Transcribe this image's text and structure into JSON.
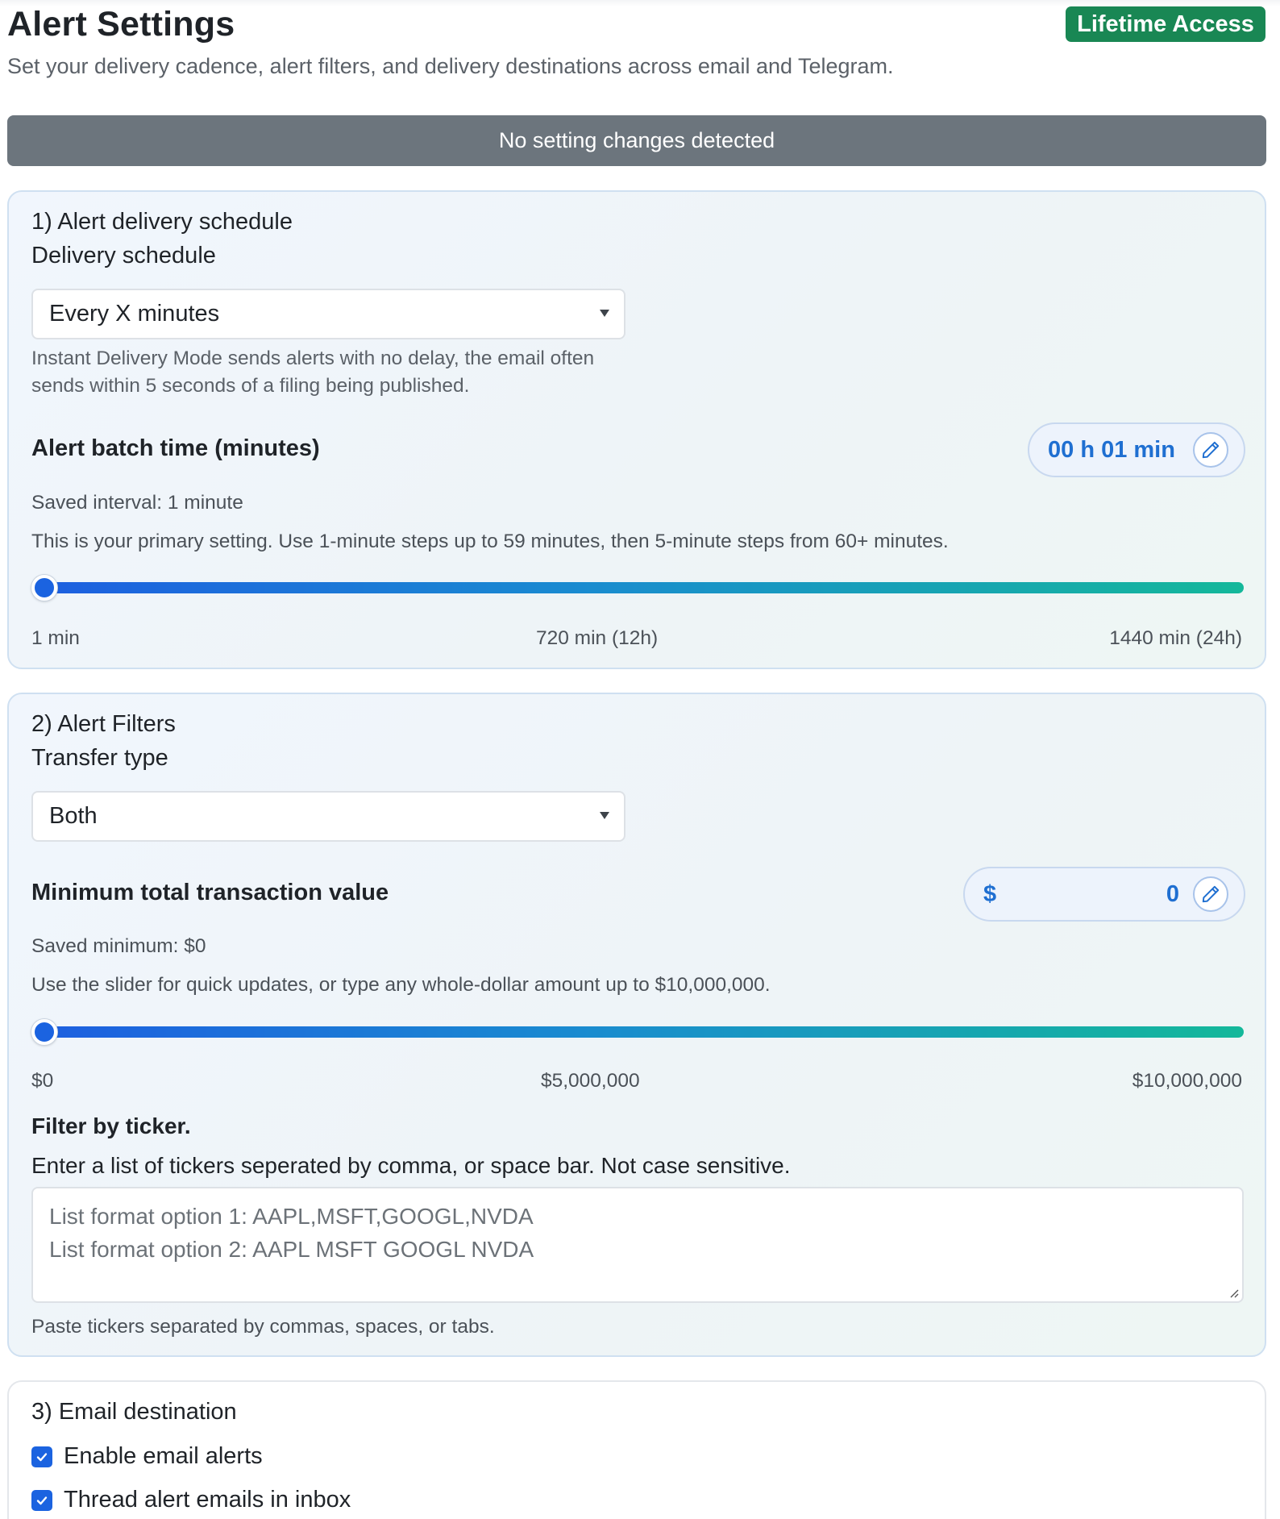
{
  "header": {
    "title": "Alert Settings",
    "badge": "Lifetime Access",
    "subtitle": "Set your delivery cadence, alert filters, and delivery destinations across email and Telegram."
  },
  "status": {
    "text": "No setting changes detected"
  },
  "schedule_section": {
    "title": "1) Alert delivery schedule",
    "schedule_label": "Delivery schedule",
    "schedule_value": "Every X minutes",
    "schedule_help_line1": "Instant Delivery Mode sends alerts with no delay, the email often",
    "schedule_help_line2": "sends within 5 seconds of a filing being published.",
    "batch_label": "Alert batch time (minutes)",
    "batch_display": "00 h 01 min",
    "saved_interval": "Saved interval: 1 minute",
    "batch_help": "This is your primary setting. Use 1-minute steps up to 59 minutes, then 5-minute steps from 60+ minutes.",
    "slider": {
      "value": 1,
      "min": 1,
      "max": 1440
    },
    "ticks": [
      "1 min",
      "720 min (12h)",
      "1440 min (24h)"
    ]
  },
  "filters_section": {
    "title": "2) Alert Filters",
    "transfer_label": "Transfer type",
    "transfer_value": "Both",
    "min_value_label": "Minimum total transaction value",
    "currency_symbol": "$",
    "min_value_display": "0",
    "saved_minimum": "Saved minimum: $0",
    "min_help": "Use the slider for quick updates, or type any whole-dollar amount up to $10,000,000.",
    "slider": {
      "value": 0,
      "min": 0,
      "max": 10000000
    },
    "ticks": [
      "$0",
      "$5,000,000",
      "$10,000,000"
    ],
    "ticker_title": "Filter by ticker.",
    "ticker_instructions": "Enter a list of tickers seperated by comma, or space bar. Not case sensitive.",
    "ticker_placeholder_line1": "List format option 1: AAPL,MSFT,GOOGL,NVDA",
    "ticker_placeholder_line2": "List format option 2: AAPL MSFT GOOGL NVDA",
    "ticker_help": "Paste tickers separated by commas, spaces, or tabs."
  },
  "email_section": {
    "title": "3) Email destination",
    "enable_label": "Enable email alerts",
    "enable_checked": true,
    "thread_label": "Thread alert emails in inbox",
    "thread_checked": true
  },
  "colors": {
    "accent": "#1b63e0",
    "badge": "#198754",
    "status_bar": "#6c757d"
  }
}
